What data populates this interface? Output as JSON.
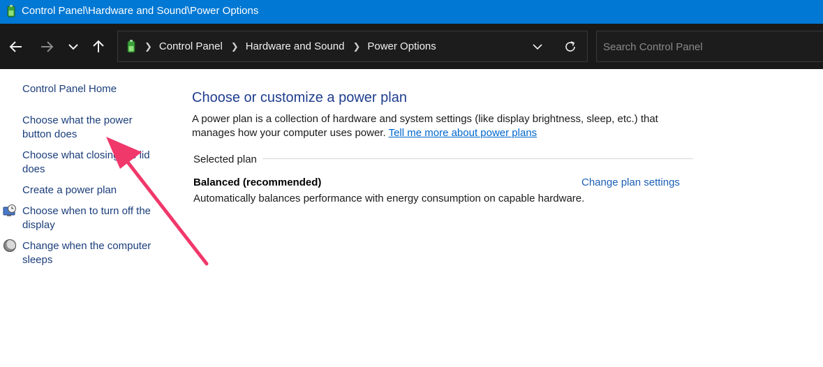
{
  "window": {
    "title": "Control Panel\\Hardware and Sound\\Power Options",
    "icon": "power-options-icon"
  },
  "navbar": {
    "back_icon": "arrow-left-icon",
    "forward_icon": "arrow-right-icon",
    "recent_icon": "chevron-down-icon",
    "up_icon": "arrow-up-icon",
    "breadcrumbs": [
      "Control Panel",
      "Hardware and Sound",
      "Power Options"
    ],
    "search_placeholder": "Search Control Panel",
    "refresh_icon": "refresh-icon"
  },
  "sidebar": {
    "items": [
      {
        "label": "Control Panel Home"
      },
      {
        "label": "Choose what the power button does"
      },
      {
        "label": "Choose what closing the lid does"
      },
      {
        "label": "Create a power plan"
      },
      {
        "label": "Choose when to turn off the display",
        "icon": "display-clock-icon"
      },
      {
        "label": "Change when the computer sleeps",
        "icon": "moon-icon"
      }
    ]
  },
  "main": {
    "title": "Choose or customize a power plan",
    "description": "A power plan is a collection of hardware and system settings (like display brightness, sleep, etc.) that manages how your computer uses power.",
    "learn_more_link": "Tell me more about power plans",
    "section_label": "Selected plan",
    "plan": {
      "name": "Balanced (recommended)",
      "change_link": "Change plan settings",
      "description": "Automatically balances performance with energy consumption on capable hardware."
    }
  },
  "colors": {
    "titlebar": "#0078d4",
    "navbar": "#191919",
    "link": "#1a3d7a",
    "heading": "#1e3d8f",
    "annotation_arrow": "#f0386b"
  }
}
